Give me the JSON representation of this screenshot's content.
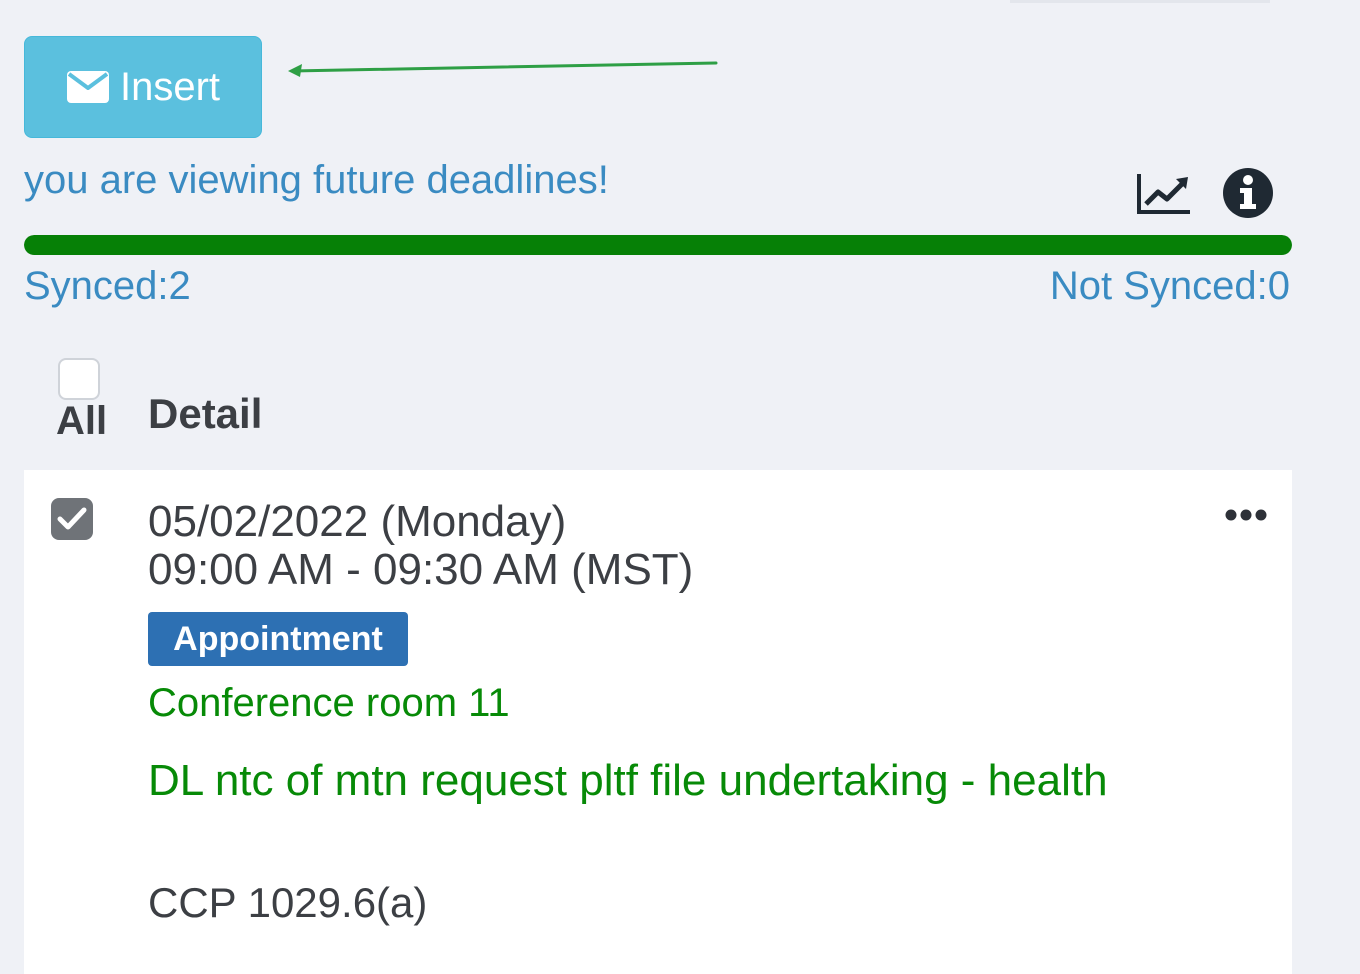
{
  "toolbar": {
    "insert_label": "Insert",
    "insert_icon": "envelope-icon",
    "button_color": "#5bc0de"
  },
  "notice": "you are viewing future deadlines!",
  "icons": {
    "chart": "line-chart-icon",
    "info": "info-circle-icon"
  },
  "sync": {
    "progress_fraction": 1.0,
    "progress_color": "#068006",
    "synced_text": "Synced:2",
    "not_synced_text": "Not Synced:0"
  },
  "table_header": {
    "all_label": "All",
    "detail_label": "Detail",
    "all_checked": false
  },
  "entries": [
    {
      "checked": true,
      "date": "05/02/2022 (Monday)",
      "time": "09:00 AM - 09:30 AM (MST)",
      "type_badge": "Appointment",
      "badge_color": "#2d70b3",
      "location": "Conference room 11",
      "description": "DL ntc of mtn request pltf file undertaking - health",
      "code": "CCP 1029.6(a)",
      "text_accent_color": "#078a07",
      "menu_icon": "more-horizontal-icon"
    }
  ]
}
